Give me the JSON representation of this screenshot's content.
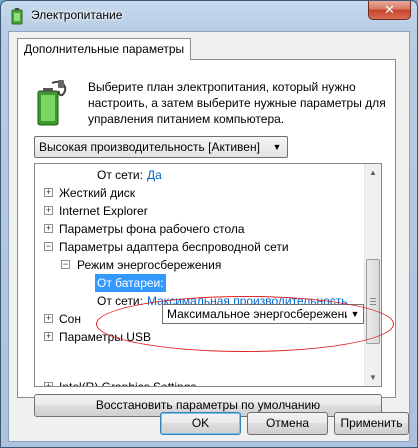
{
  "window": {
    "title": "Электропитание",
    "close_glyph": "✕"
  },
  "tab": {
    "label": "Дополнительные параметры"
  },
  "description": "Выберите план электропитания, который нужно настроить, а затем выберите нужные параметры для управления питанием компьютера.",
  "plan_select": {
    "value": "Высокая производительность [Активен]"
  },
  "tree": {
    "rows": [
      {
        "kind": "setting",
        "label": "От сети:",
        "value": "Да"
      },
      {
        "kind": "group",
        "label": "Жесткий диск",
        "expander": "+"
      },
      {
        "kind": "group",
        "label": "Internet Explorer",
        "expander": "+"
      },
      {
        "kind": "group",
        "label": "Параметры фона рабочего стола",
        "expander": "+"
      },
      {
        "kind": "group",
        "label": "Параметры адаптера беспроводной сети",
        "expander": "−"
      },
      {
        "kind": "subgroup",
        "label": "Режим энергосбережения",
        "expander": "−"
      },
      {
        "kind": "setting-edit",
        "label": "От батареи:",
        "value": "Максимальное энергосбережение"
      },
      {
        "kind": "setting",
        "label": "От сети:",
        "value": "Максимальная производительность"
      },
      {
        "kind": "group",
        "label": "Сон",
        "expander": "+"
      },
      {
        "kind": "group",
        "label": "Параметры USB",
        "expander": "+"
      },
      {
        "kind": "group",
        "label": "Intel(R) Graphics Settings",
        "expander": "+"
      }
    ]
  },
  "buttons": {
    "restore": "Восстановить параметры по умолчанию",
    "ok": "OK",
    "cancel": "Отмена",
    "apply": "Применить"
  }
}
